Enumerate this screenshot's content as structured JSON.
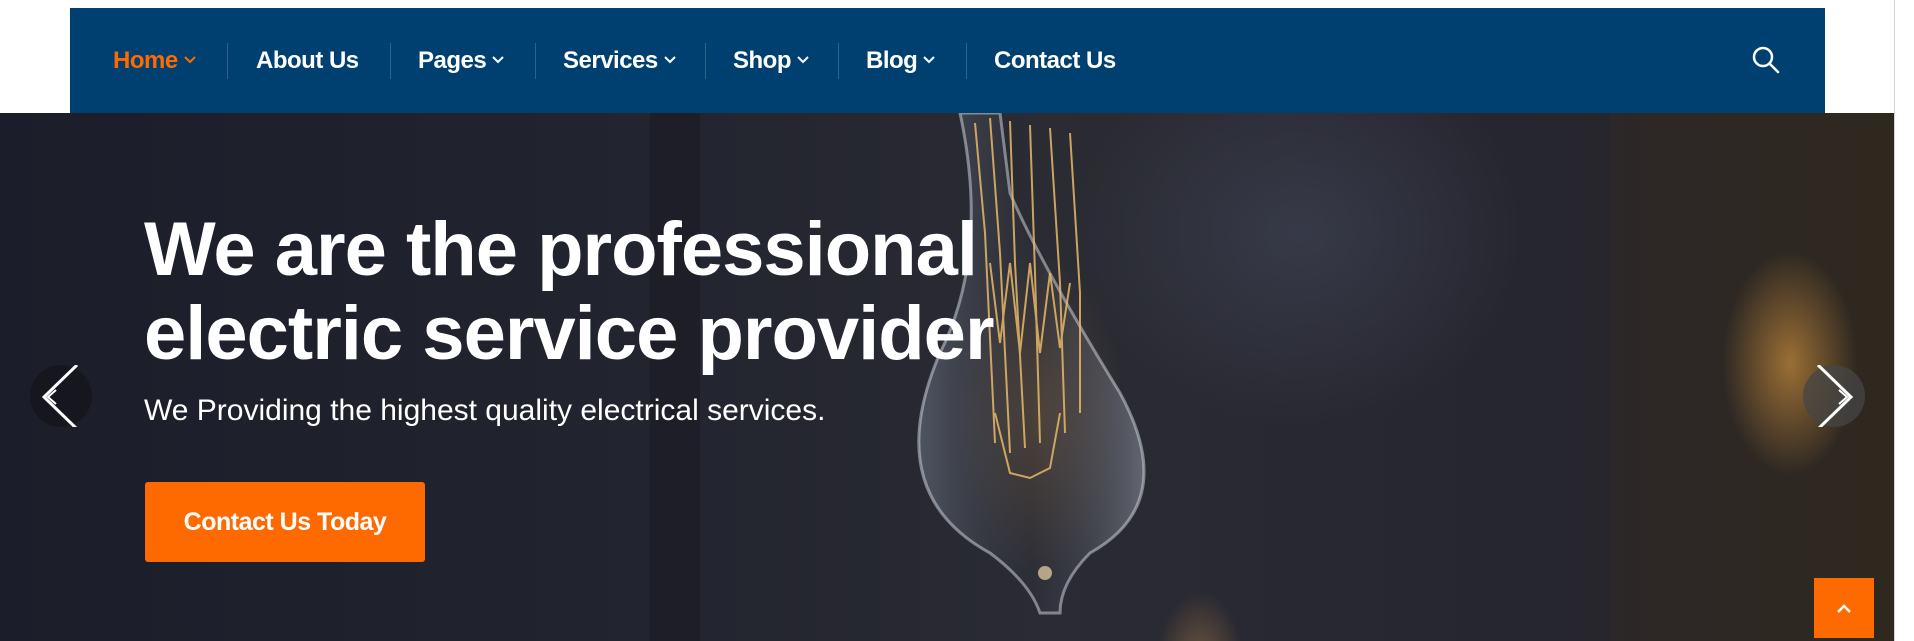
{
  "nav": {
    "items": [
      {
        "label": "Home",
        "active": true,
        "has_dropdown": true
      },
      {
        "label": "About Us",
        "active": false,
        "has_dropdown": false
      },
      {
        "label": "Pages",
        "active": false,
        "has_dropdown": true
      },
      {
        "label": "Services",
        "active": false,
        "has_dropdown": true
      },
      {
        "label": "Shop",
        "active": false,
        "has_dropdown": true
      },
      {
        "label": "Blog",
        "active": false,
        "has_dropdown": true
      },
      {
        "label": "Contact Us",
        "active": false,
        "has_dropdown": false
      }
    ],
    "search_icon": "search-icon"
  },
  "hero": {
    "title": "We are the professional\nelectric service provider",
    "subtitle": "We Providing the highest quality electrical services.",
    "cta_label": "Contact Us Today",
    "prev_icon": "chevron-left-icon",
    "next_icon": "chevron-right-icon"
  },
  "scroll_top_icon": "chevron-up-icon",
  "colors": {
    "nav_bg": "#004070",
    "accent": "#ff6a00",
    "text": "#ffffff",
    "hero_bg": "#1f2130"
  }
}
